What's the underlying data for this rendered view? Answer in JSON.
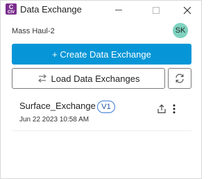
{
  "window": {
    "title": "Data Exchange",
    "app_icon_letter": "C",
    "app_icon_sub": "CIV"
  },
  "header": {
    "project_name": "Mass Haul-2",
    "avatar_initials": "SK"
  },
  "actions": {
    "create_label": "+ Create Data Exchange",
    "load_label": "Load Data Exchanges"
  },
  "exchanges": [
    {
      "name": "Surface_Exchange",
      "version": "V1",
      "date": "Jun 22 2023 10:58 AM"
    }
  ],
  "colors": {
    "primary": "#0696d7",
    "avatar": "#7fd3c0",
    "app_icon": "#7b2d8e",
    "version_badge": "#3a7bd5"
  },
  "icons": {
    "load": "swap-arrows-icon",
    "refresh": "refresh-icon",
    "share": "share-icon",
    "more": "more-vertical-icon"
  }
}
